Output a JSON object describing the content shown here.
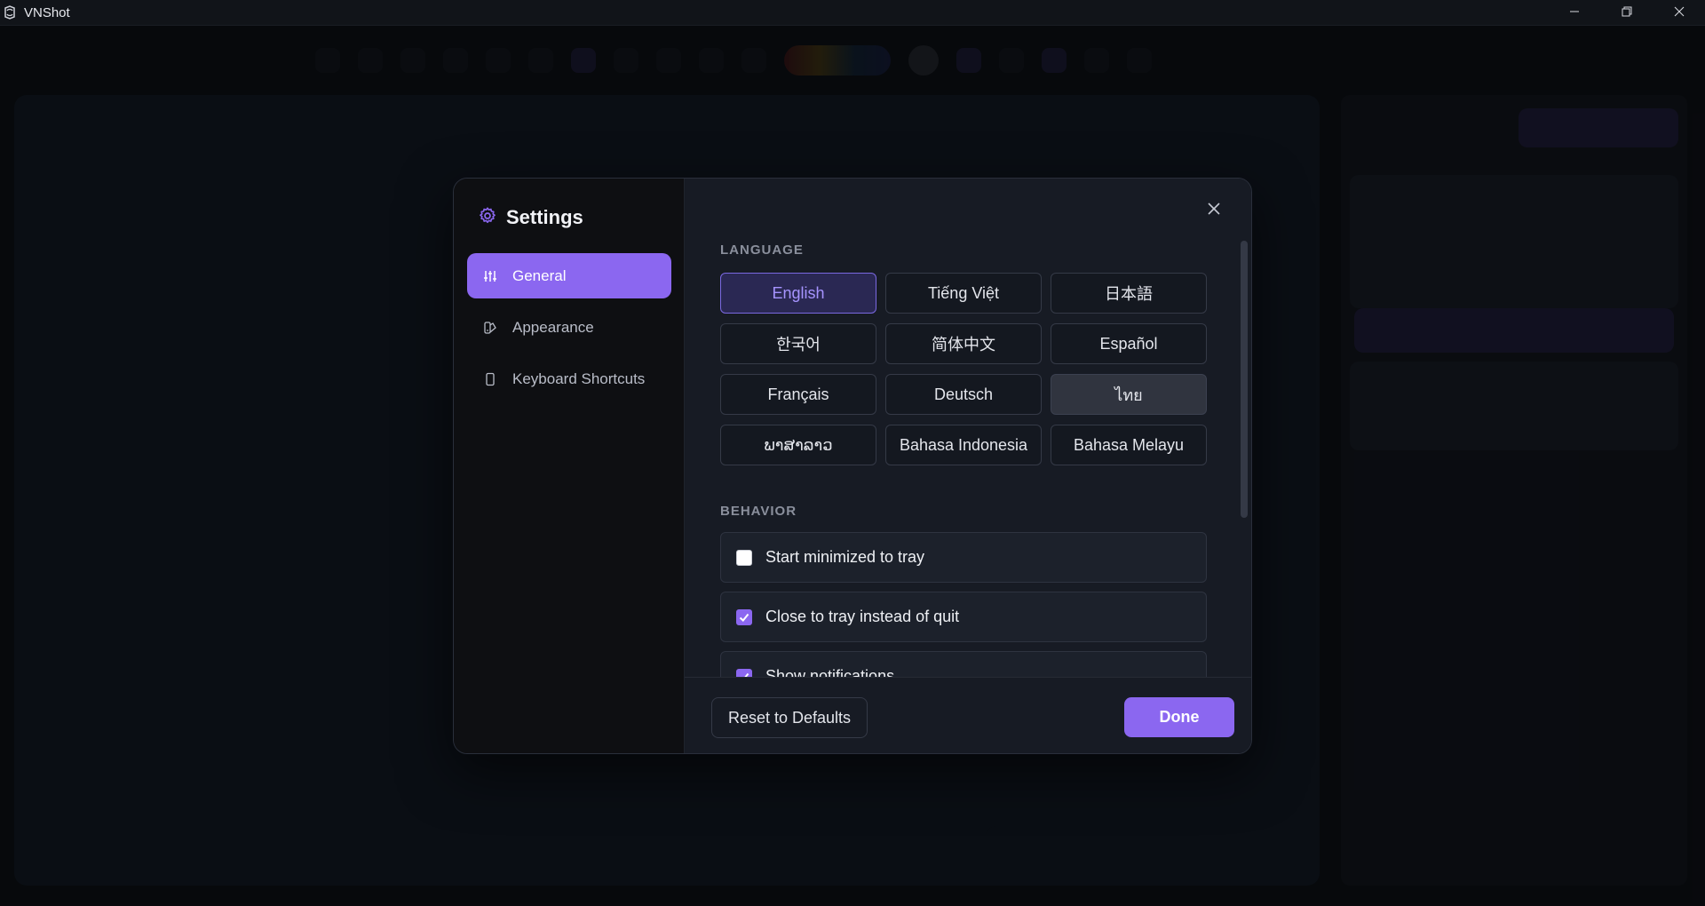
{
  "window": {
    "title": "VNShot",
    "icons": {
      "logo": "app-logo-icon",
      "minimize": "minimize-icon",
      "maximize": "restore-icon",
      "close": "close-icon"
    }
  },
  "colors": {
    "accent": "#8b67f0",
    "selected_text": "#a694ff",
    "modal_bg": "#171b24",
    "sidebar_bg": "#0e0f12"
  },
  "settings": {
    "title": "Settings",
    "title_icon": "gear-icon",
    "nav": [
      {
        "label": "General",
        "icon": "sliders-icon",
        "active": true
      },
      {
        "label": "Appearance",
        "icon": "palette-icon",
        "active": false
      },
      {
        "label": "Keyboard Shortcuts",
        "icon": "keyboard-icon",
        "active": false
      }
    ],
    "language": {
      "heading": "LANGUAGE",
      "options": [
        "English",
        "Tiếng Việt",
        "日本語",
        "한국어",
        "简体中文",
        "Español",
        "Français",
        "Deutsch",
        "ไทย",
        "ພາສາລາວ",
        "Bahasa Indonesia",
        "Bahasa Melayu"
      ],
      "selected": "English"
    },
    "behavior": {
      "heading": "BEHAVIOR",
      "items": [
        {
          "label": "Start minimized to tray",
          "checked": false
        },
        {
          "label": "Close to tray instead of quit",
          "checked": true
        },
        {
          "label": "Show notifications",
          "checked": true
        }
      ]
    },
    "footer": {
      "reset_label": "Reset to Defaults",
      "done_label": "Done"
    }
  }
}
